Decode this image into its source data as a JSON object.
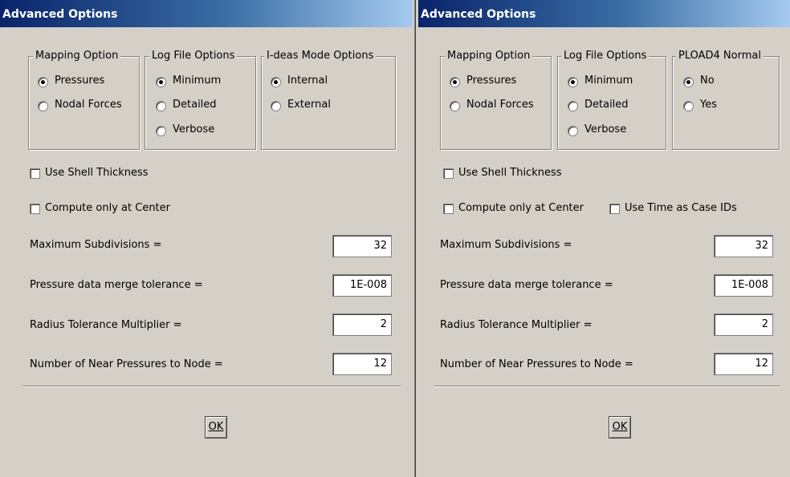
{
  "dialog1": {
    "title": "Advanced Options",
    "groups": {
      "mapping": {
        "label": "Mapping Option",
        "options": [
          "Pressures",
          "Nodal Forces"
        ]
      },
      "logfile": {
        "label": "Log File Options",
        "options": [
          "Minimum",
          "Detailed",
          "Verbose"
        ]
      },
      "mode": {
        "label": "I-deas Mode Options",
        "options": [
          "Internal",
          "External"
        ]
      }
    },
    "checkboxes": {
      "shell": "Use Shell Thickness",
      "center": "Compute only at Center"
    },
    "fields": [
      {
        "label": "Maximum Subdivisions =",
        "value": "32"
      },
      {
        "label": "Pressure data merge tolerance =",
        "value": "1E-008"
      },
      {
        "label": "Radius Tolerance Multiplier =",
        "value": "2"
      },
      {
        "label": "Number of Near Pressures to Node =",
        "value": "12"
      }
    ],
    "ok_label": "OK"
  },
  "dialog2": {
    "title": "Advanced Options",
    "groups": {
      "mapping": {
        "label": "Mapping Option",
        "options": [
          "Pressures",
          "Nodal Forces"
        ]
      },
      "logfile": {
        "label": "Log File Options",
        "options": [
          "Minimum",
          "Detailed",
          "Verbose"
        ]
      },
      "pload": {
        "label": "PLOAD4 Normal",
        "options": [
          "No",
          "Yes"
        ]
      }
    },
    "checkboxes": {
      "shell": "Use Shell Thickness",
      "center": "Compute only at Center",
      "timecase": "Use Time as Case IDs"
    },
    "fields": [
      {
        "label": "Maximum Subdivisions =",
        "value": "32"
      },
      {
        "label": "Pressure data merge tolerance =",
        "value": "1E-008"
      },
      {
        "label": "Radius Tolerance Multiplier =",
        "value": "2"
      },
      {
        "label": "Number of Near Pressures to Node =",
        "value": "12"
      }
    ],
    "ok_label": "OK"
  },
  "colors": {
    "titlebar_start": "#0a246a",
    "titlebar_end": "#a6caf0",
    "face": "#d4d0c8"
  }
}
